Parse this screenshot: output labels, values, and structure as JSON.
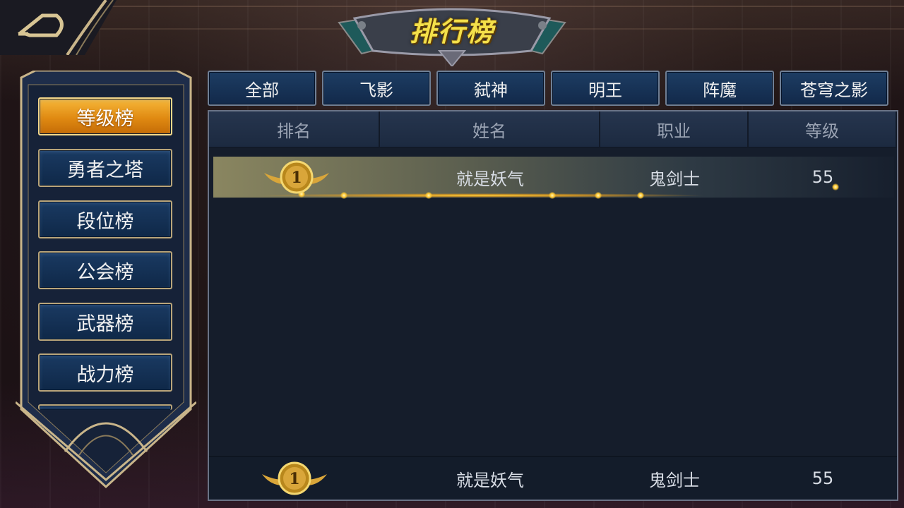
{
  "back_button": {
    "icon": "back-arrow-icon"
  },
  "title": "排行榜",
  "side_menu": [
    {
      "label": "等级榜",
      "active": true
    },
    {
      "label": "勇者之塔",
      "active": false
    },
    {
      "label": "段位榜",
      "active": false
    },
    {
      "label": "公会榜",
      "active": false
    },
    {
      "label": "武器榜",
      "active": false
    },
    {
      "label": "战力榜",
      "active": false
    }
  ],
  "tabs": [
    "全部",
    "飞影",
    "弑神",
    "明王",
    "阵魔",
    "苍穹之影"
  ],
  "columns": [
    "排名",
    "姓名",
    "职业",
    "等级"
  ],
  "rows": [
    {
      "rank": "1",
      "name": "就是妖气",
      "class": "鬼剑士",
      "level": "55"
    }
  ],
  "my_rank": {
    "rank": "1",
    "name": "就是妖气",
    "class": "鬼剑士",
    "level": "55"
  },
  "colors": {
    "active_tab": "#e08a12",
    "panel": "#151d2b",
    "gold": "#f4e04a"
  }
}
